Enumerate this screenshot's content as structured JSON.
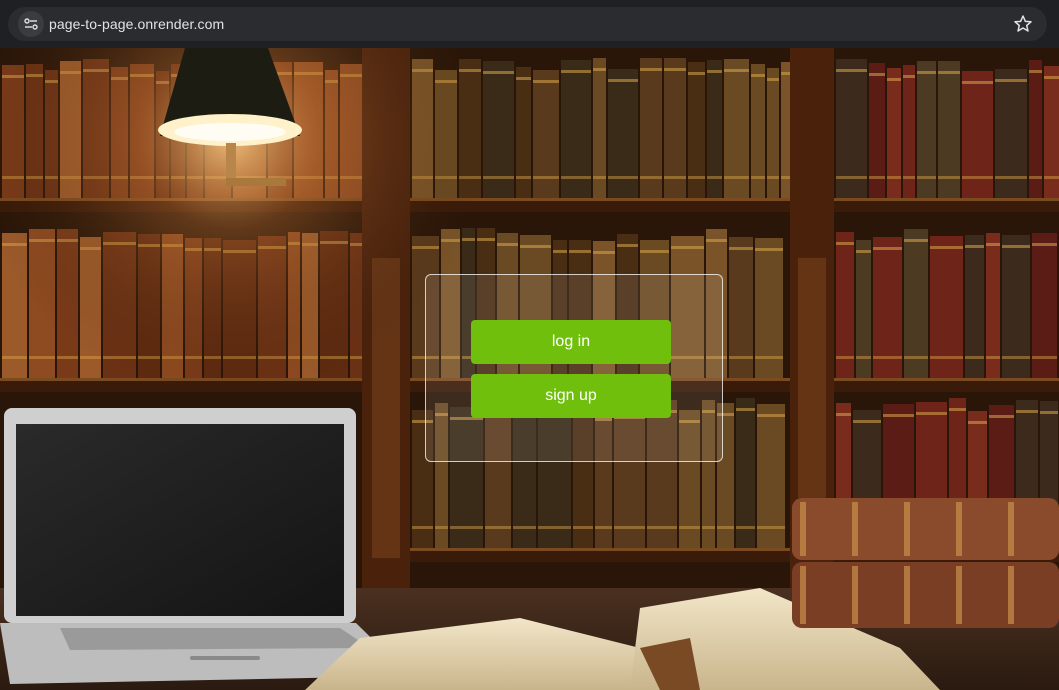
{
  "browser": {
    "url": "page-to-page.onrender.com",
    "site_info_icon": "tune-icon",
    "bookmark_icon": "star-icon"
  },
  "auth_panel": {
    "login_label": "log in",
    "signup_label": "sign up"
  },
  "colors": {
    "button_green": "#6fbf0c",
    "panel_border": "#ffffff"
  }
}
